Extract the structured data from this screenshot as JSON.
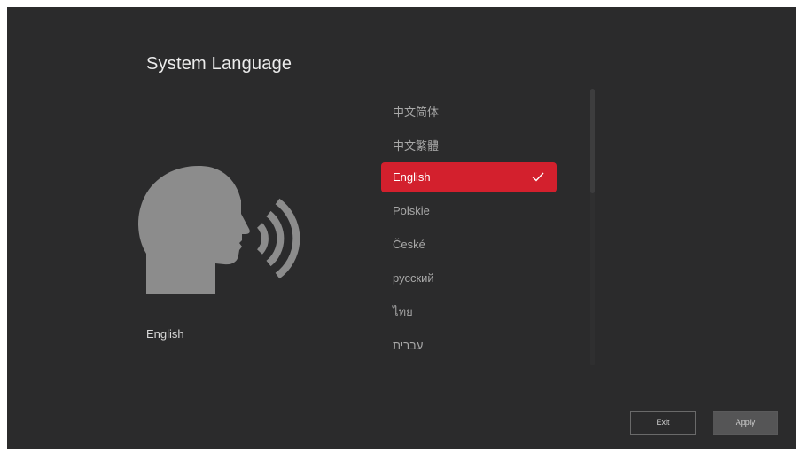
{
  "page": {
    "title": "System Language",
    "current_language": "English"
  },
  "language_list": {
    "items": [
      {
        "label": "中文简体",
        "selected": false
      },
      {
        "label": "中文繁體",
        "selected": false
      },
      {
        "label": "English",
        "selected": true
      },
      {
        "label": "Polskie",
        "selected": false
      },
      {
        "label": "České",
        "selected": false
      },
      {
        "label": "русский",
        "selected": false
      },
      {
        "label": "ไทย",
        "selected": false
      },
      {
        "label": "עברית",
        "selected": false
      }
    ],
    "scroll_fraction_visible": 0.38
  },
  "buttons": {
    "exit_label": "Exit",
    "apply_label": "Apply"
  },
  "icons": {
    "illustration": "speaking-head-icon",
    "selected_marker": "check-icon"
  },
  "colors": {
    "background": "#2b2b2c",
    "accent": "#d3202d",
    "text_primary": "#ececec",
    "text_secondary": "#a8a8a8",
    "illustration": "#8c8c8c"
  }
}
